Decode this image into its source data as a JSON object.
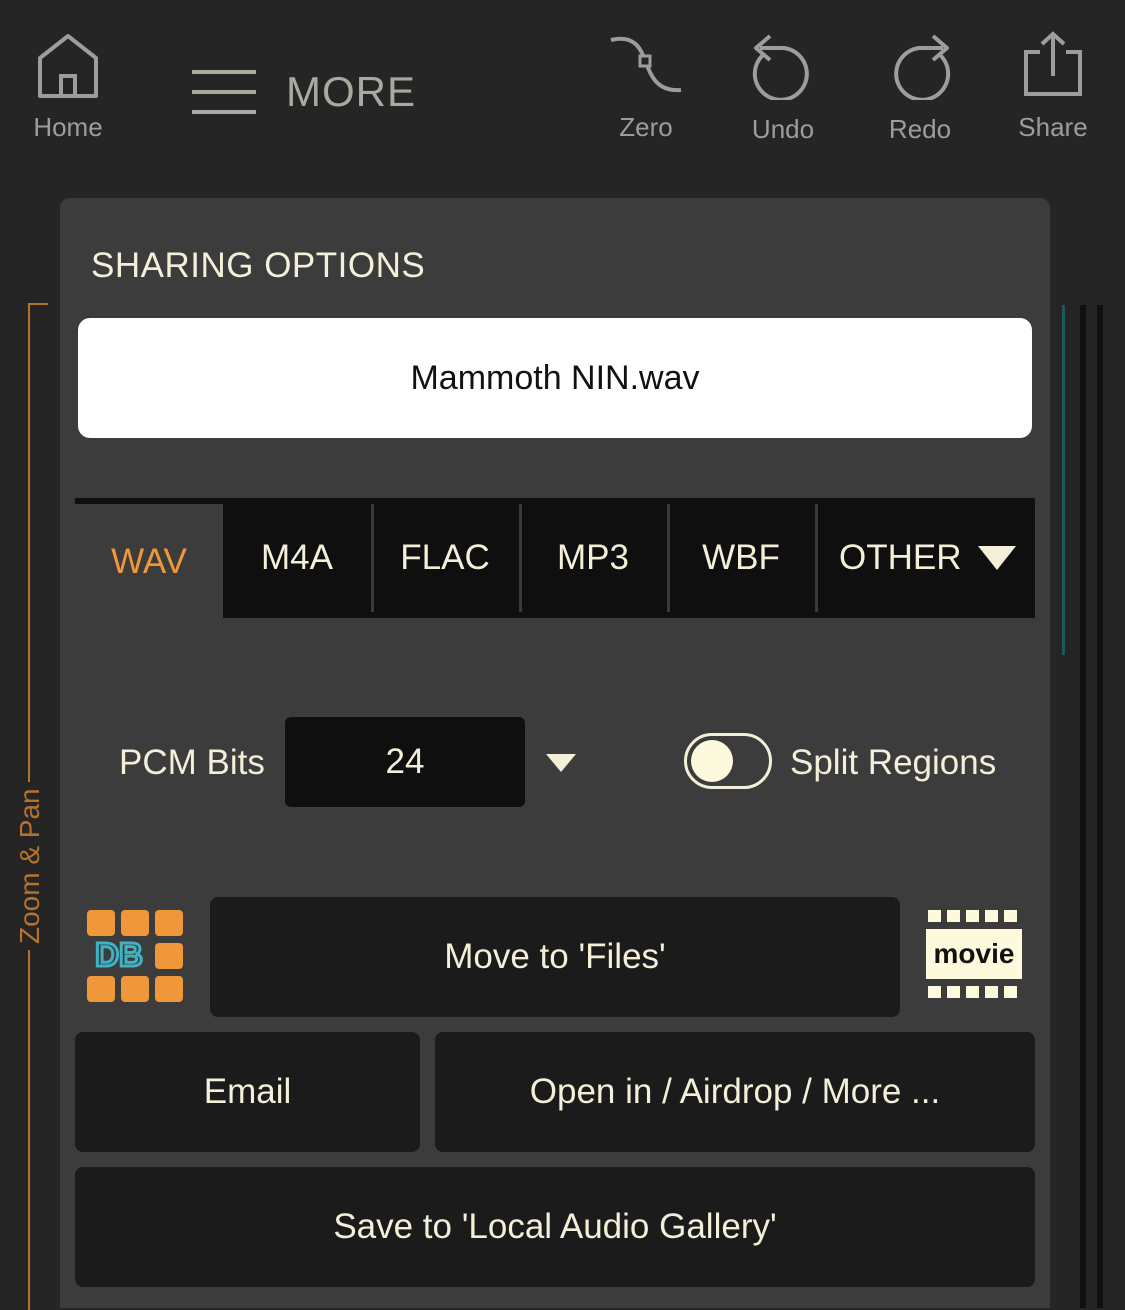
{
  "toolbar": {
    "home_label": "Home",
    "menu_label": "MORE",
    "zero_label": "Zero",
    "undo_label": "Undo",
    "redo_label": "Redo",
    "share_label": "Share"
  },
  "background": {
    "side_label": "Zoom & Pan"
  },
  "sharing": {
    "title": "SHARING OPTIONS",
    "filename": "Mammoth NIN.wav",
    "tabs": [
      {
        "label": "WAV",
        "active": true
      },
      {
        "label": "M4A",
        "active": false
      },
      {
        "label": "FLAC",
        "active": false
      },
      {
        "label": "MP3",
        "active": false
      },
      {
        "label": "WBF",
        "active": false
      },
      {
        "label": "OTHER",
        "active": false
      }
    ],
    "pcm_bits_label": "PCM Bits",
    "pcm_bits_value": "24",
    "split_regions_label": "Split Regions",
    "split_regions_on": false,
    "db_icon_text": "DB",
    "movie_icon_text": "movie",
    "move_files_label": "Move to 'Files'",
    "email_label": "Email",
    "open_in_label": "Open in / Airdrop / More ...",
    "save_gallery_label": "Save to 'Local Audio Gallery'"
  },
  "colors": {
    "accent": "#f0973a",
    "text": "#f3efd8",
    "panel": "#3c3c3c",
    "button": "#1b1b1b",
    "db_blue": "#3fb3c4"
  }
}
